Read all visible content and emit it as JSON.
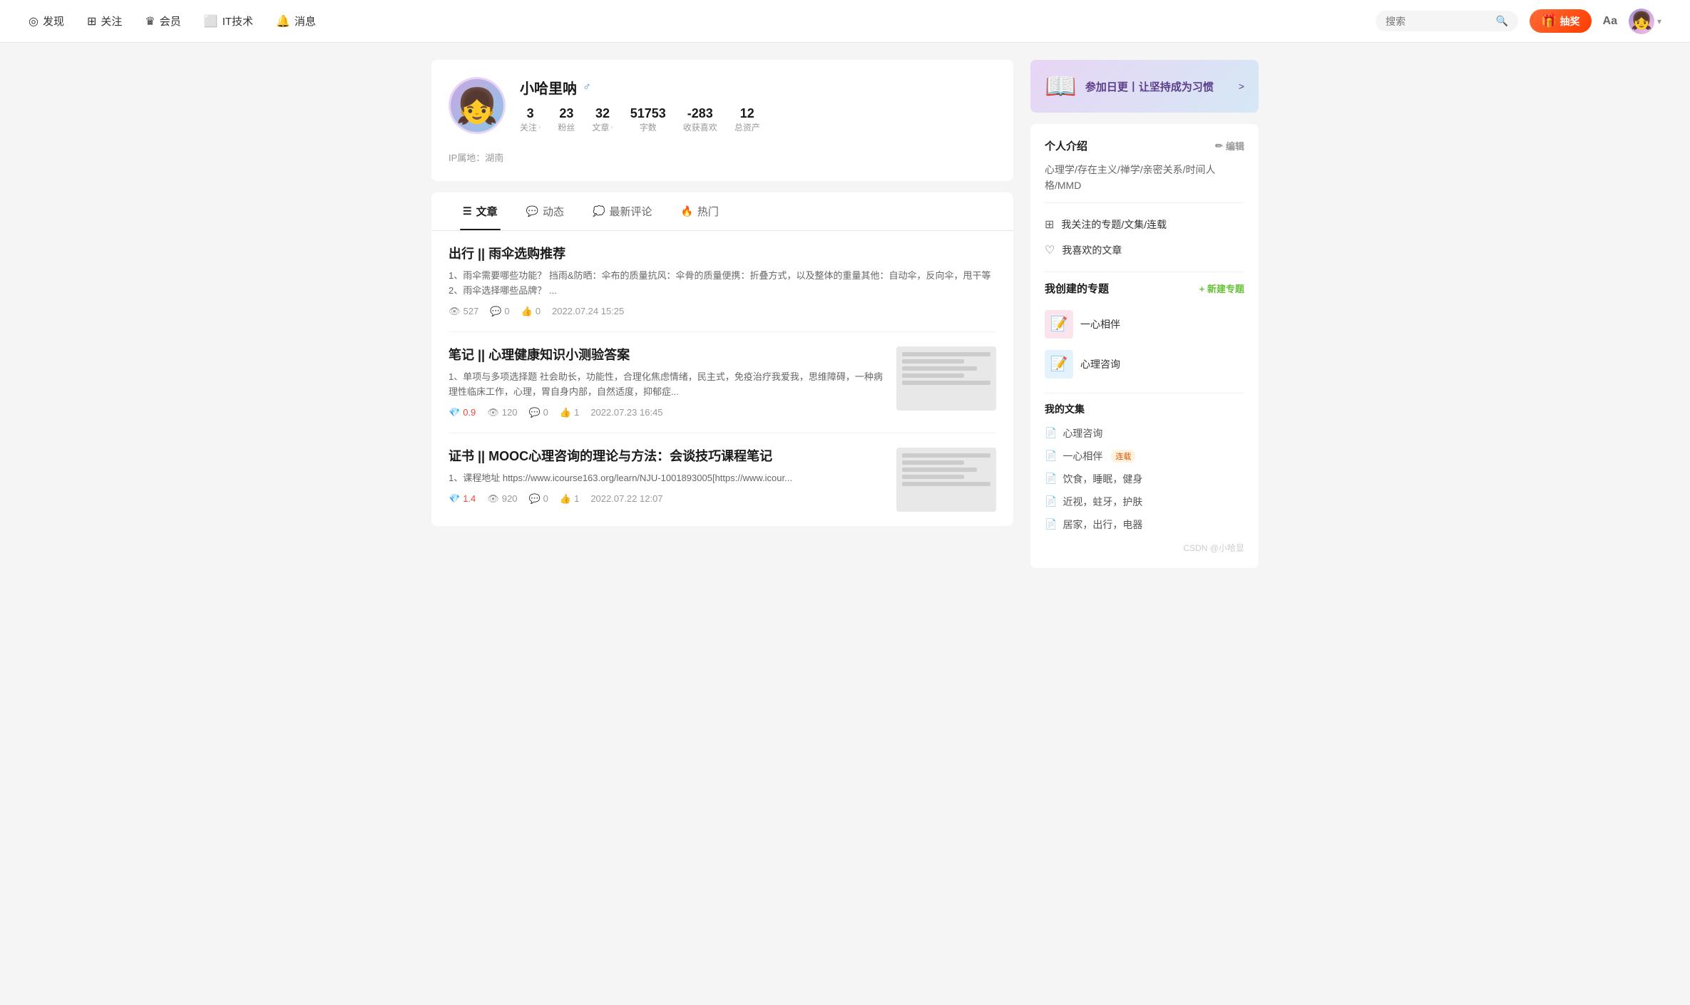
{
  "header": {
    "nav": [
      {
        "id": "discover",
        "label": "发现",
        "icon": "◎"
      },
      {
        "id": "follow",
        "label": "关注",
        "icon": "⊞"
      },
      {
        "id": "vip",
        "label": "会员",
        "icon": "♛"
      },
      {
        "id": "it",
        "label": "IT技术",
        "icon": "⬜"
      },
      {
        "id": "message",
        "label": "消息",
        "icon": "🔔"
      }
    ],
    "search_placeholder": "搜索",
    "lottery_label": "抽奖",
    "font_label": "Aa"
  },
  "profile": {
    "name": "小哈里呐",
    "gender": "♂",
    "stats": [
      {
        "value": "3",
        "label": "关注",
        "arrow": true
      },
      {
        "value": "23",
        "label": "粉丝",
        "arrow": false
      },
      {
        "value": "32",
        "label": "文章",
        "arrow": true
      },
      {
        "value": "51753",
        "label": "字数"
      },
      {
        "value": "-283",
        "label": "收获喜欢"
      },
      {
        "value": "12",
        "label": "总资产"
      }
    ],
    "ip": "IP属地：湖南"
  },
  "tabs": [
    {
      "id": "articles",
      "label": "文章",
      "icon": "☰",
      "active": true
    },
    {
      "id": "dynamic",
      "label": "动态",
      "icon": "💬"
    },
    {
      "id": "comments",
      "label": "最新评论",
      "icon": "💭"
    },
    {
      "id": "hot",
      "label": "热门",
      "icon": "🔥"
    }
  ],
  "articles": [
    {
      "id": 1,
      "title": "出行 || 雨伞选购推荐",
      "excerpt": "1、雨伞需要哪些功能？ 挡雨&防晒：伞布的质量抗风：伞骨的质量便携：折叠方式，以及整体的重量其他：自动伞，反向伞，甩干等 2、雨伞选择哪些品牌？ ...",
      "has_thumb": false,
      "views": "527",
      "comments": "0",
      "likes": "0",
      "date": "2022.07.24 15:25",
      "diamond": null
    },
    {
      "id": 2,
      "title": "笔记 || 心理健康知识小测验答案",
      "excerpt": "1、单项与多项选择题 社会助长，功能性，合理化焦虑情绪，民主式，免疫治疗我爱我，思维障碍，一种病理性临床工作，心理，胃自身内部，自然适度，抑郁症...",
      "has_thumb": true,
      "views": "120",
      "comments": "0",
      "likes": "1",
      "date": "2022.07.23 16:45",
      "diamond": "0.9"
    },
    {
      "id": 3,
      "title": "证书 || MOOC心理咨询的理论与方法：会谈技巧课程笔记",
      "excerpt": "1、课程地址 https://www.icourse163.org/learn/NJU-1001893005[https://www.icour...",
      "has_thumb": true,
      "views": "920",
      "comments": "0",
      "likes": "1",
      "date": "2022.07.22 12:07",
      "diamond": "1.4"
    }
  ],
  "sidebar": {
    "checkin": {
      "text": "参加日更丨让坚持成为习惯",
      "arrow": ">"
    },
    "intro": {
      "title": "个人介绍",
      "edit_label": "编辑",
      "edit_icon": "✏",
      "bio": "心理学/存在主义/禅学/亲密关系/时间人格/MMD"
    },
    "links": [
      {
        "icon": "⊞",
        "label": "我关注的专题/文集/连载"
      },
      {
        "icon": "♡",
        "label": "我喜欢的文章"
      }
    ],
    "my_topics": {
      "title": "我创建的专题",
      "new_btn": "+ 新建专题",
      "items": [
        {
          "name": "一心相伴",
          "color": "#fce4ec"
        },
        {
          "name": "心理咨询",
          "color": "#e3f2fd"
        }
      ]
    },
    "my_collections": {
      "title": "我的文集",
      "items": [
        {
          "label": "心理咨询",
          "tag": null
        },
        {
          "label": "一心相伴",
          "tag": "连载"
        },
        {
          "label": "饮食，睡眠，健身",
          "tag": null
        },
        {
          "label": "近视，蛀牙，护肤",
          "tag": null
        },
        {
          "label": "居家，出行，电器",
          "tag": null
        }
      ]
    },
    "footer": "CSDN @小哈显"
  }
}
